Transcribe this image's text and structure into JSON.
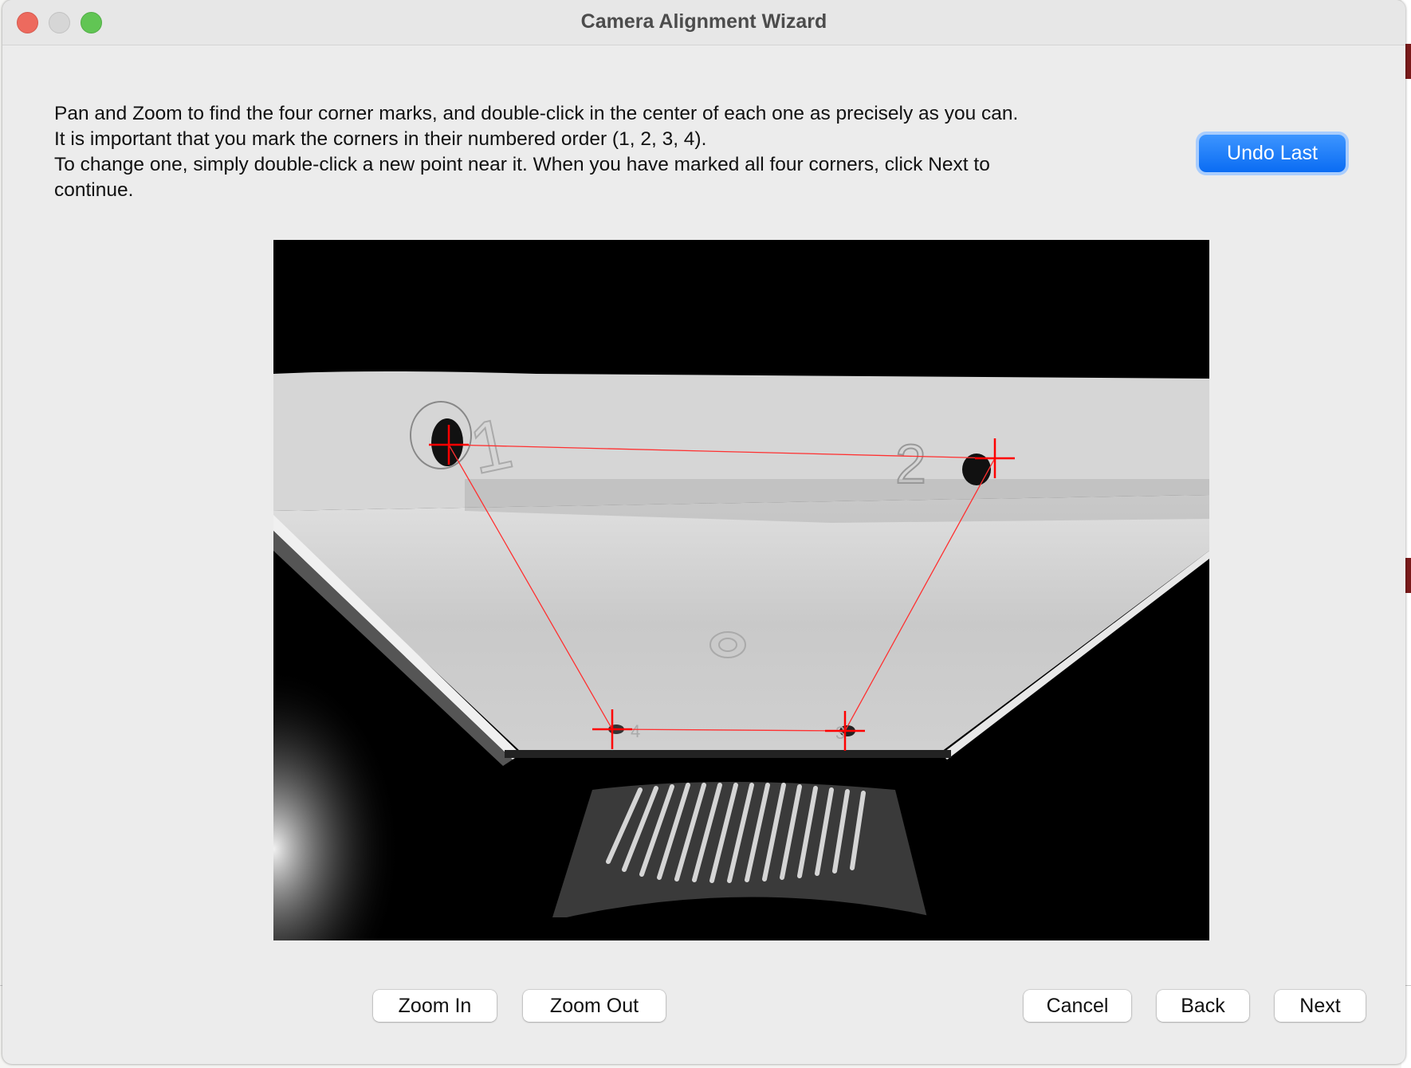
{
  "window": {
    "title": "Camera Alignment Wizard"
  },
  "instructions": [
    "Pan and Zoom to find the four corner marks, and double-click in the center of each one as precisely as you can.",
    "It is important that you mark the corners in their numbered order (1, 2, 3, 4).",
    "To change one, simply double-click a new point near it.  When you have marked all four corners, click Next to",
    "continue."
  ],
  "buttons": {
    "undo_last": "Undo Last",
    "zoom_in": "Zoom In",
    "zoom_out": "Zoom Out",
    "cancel": "Cancel",
    "back": "Back",
    "next": "Next"
  },
  "camera": {
    "corner_labels": [
      "1",
      "2",
      "3",
      "4"
    ],
    "marker_color": "#ff0000"
  },
  "colors": {
    "accent": "#0a6cf3"
  }
}
